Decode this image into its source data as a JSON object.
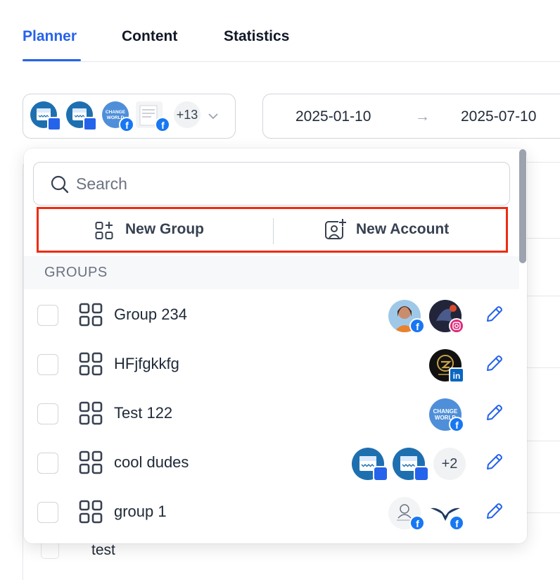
{
  "tabs": [
    {
      "label": "Planner",
      "active": true
    },
    {
      "label": "Content",
      "active": false
    },
    {
      "label": "Statistics",
      "active": false
    }
  ],
  "account_selector": {
    "more_count": "+13",
    "accounts": [
      {
        "kind": "google-business-icon",
        "badge": "google-business-badge"
      },
      {
        "kind": "google-business-icon",
        "badge": "google-business-badge"
      },
      {
        "kind": "change-world-logo",
        "text": "CHANGE WORLD",
        "badge": "facebook-badge"
      },
      {
        "kind": "document-thumbnail",
        "badge": "facebook-badge"
      }
    ]
  },
  "date_range": {
    "start": "2025-01-10",
    "end": "2025-07-10",
    "arrow": "→"
  },
  "dropdown": {
    "search": {
      "placeholder": "Search",
      "value": ""
    },
    "new_group_label": "New Group",
    "new_account_label": "New Account",
    "groups_header": "GROUPS",
    "groups": [
      {
        "name": "Group 234",
        "accounts": [
          "woman-portrait-facebook",
          "dark-art-instagram"
        ]
      },
      {
        "name": "HFjfgkkfg",
        "accounts": [
          "dark-logo-linkedin"
        ]
      },
      {
        "name": "Test 122",
        "accounts": [
          "change-world-facebook"
        ]
      },
      {
        "name": "cool dudes",
        "accounts": [
          "google-business",
          "google-business"
        ],
        "more": "+2"
      },
      {
        "name": "group 1",
        "accounts": [
          "sketch-logo-facebook",
          "eagle-logo-facebook"
        ]
      }
    ]
  },
  "background_row": {
    "name": "test"
  },
  "colors": {
    "accent": "#2563eb",
    "highlight": "#ef2b10",
    "facebook": "#1877f2",
    "linkedin": "#0a66c2"
  }
}
